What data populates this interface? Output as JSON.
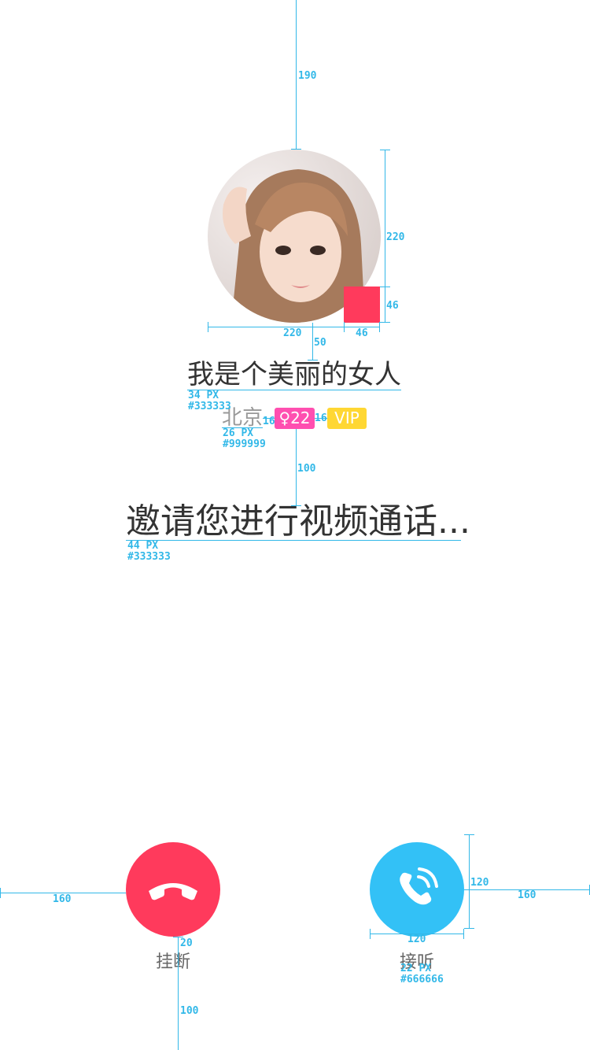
{
  "caller": {
    "name": "我是个美丽的女人",
    "city": "北京",
    "age_tag": "♀22",
    "vip_tag": "VIP",
    "avatar_icon": "user-avatar-photo"
  },
  "invite_text": "邀请您进行视频通话...",
  "actions": {
    "hangup_label": "挂断",
    "answer_label": "接听",
    "hangup_icon": "phone-hangup-icon",
    "answer_icon": "phone-answer-icon"
  },
  "colors": {
    "hangup": "#ff3a5c",
    "answer": "#33c1f6",
    "age_tag": "#ff4fb0",
    "vip_tag": "#ffd733",
    "title_text": "#333333",
    "sub_text": "#999999",
    "label_text": "#666666"
  },
  "annotations": {
    "top_gap": "190",
    "avatar_size_v": "220",
    "avatar_size_h": "220",
    "badge_v": "46",
    "badge_h": "46",
    "gap_name": "50",
    "name_spec_size": "34 PX",
    "name_spec_color": "#333333",
    "city_spec_size": "26 PX",
    "city_spec_color": "#999999",
    "tag_gap_left": "16",
    "tag_gap_right": "16",
    "gap_invite": "100",
    "invite_spec_size": "44 PX",
    "invite_spec_color": "#333333",
    "left_margin": "160",
    "right_margin": "160",
    "btn_size_v": "120",
    "btn_size_h": "120",
    "label_gap": "20",
    "label_spec_size": "22 PX",
    "label_spec_color": "#666666",
    "bottom_gap": "100"
  }
}
